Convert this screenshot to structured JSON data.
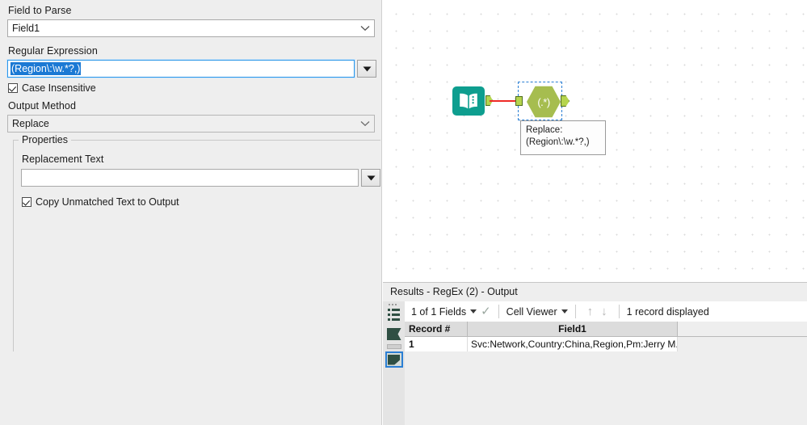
{
  "config_panel": {
    "field_to_parse": {
      "label": "Field to Parse",
      "value": "Field1"
    },
    "regular_expression": {
      "label": "Regular Expression",
      "value": "(Region\\:\\w.*?,)"
    },
    "case_insensitive": {
      "label": "Case Insensitive",
      "checked": true
    },
    "output_method": {
      "label": "Output Method",
      "value": "Replace"
    },
    "properties": {
      "title": "Properties",
      "replacement_text": {
        "label": "Replacement Text",
        "value": "",
        "placeholder": ""
      },
      "copy_unmatched": {
        "label": "Copy Unmatched Text to Output",
        "checked": true
      }
    }
  },
  "canvas": {
    "tools": [
      {
        "name": "text-input-tool",
        "icon": "book-icon"
      },
      {
        "name": "regex-tool",
        "icon": "regex-hexagon-icon",
        "glyph": "(.*)",
        "selected": true
      }
    ],
    "annotation": {
      "line1": "Replace:",
      "line2": "(Region\\:\\w.*?,)"
    },
    "connection_color": "#ee2b26"
  },
  "results": {
    "title": "Results - RegEx (2) - Output",
    "toolbar": {
      "fields_selector": "1 of 1 Fields",
      "viewer_selector": "Cell Viewer",
      "record_status": "1 record displayed"
    },
    "table": {
      "columns": [
        "Record #",
        "Field1"
      ],
      "rows": [
        {
          "record": "1",
          "field1": "Svc:Network,Country:China,Region,Pm:Jerry  M..."
        }
      ]
    }
  },
  "colors": {
    "panel_bg": "#eeeeee",
    "accent_blue": "#2b7fd4",
    "selection_blue": "#1b79d4",
    "tool_teal": "#0e9e8f",
    "tool_olive": "#a6bd4f",
    "connector_green": "#b5d44e",
    "rail_dark_green": "#2f4f43"
  }
}
